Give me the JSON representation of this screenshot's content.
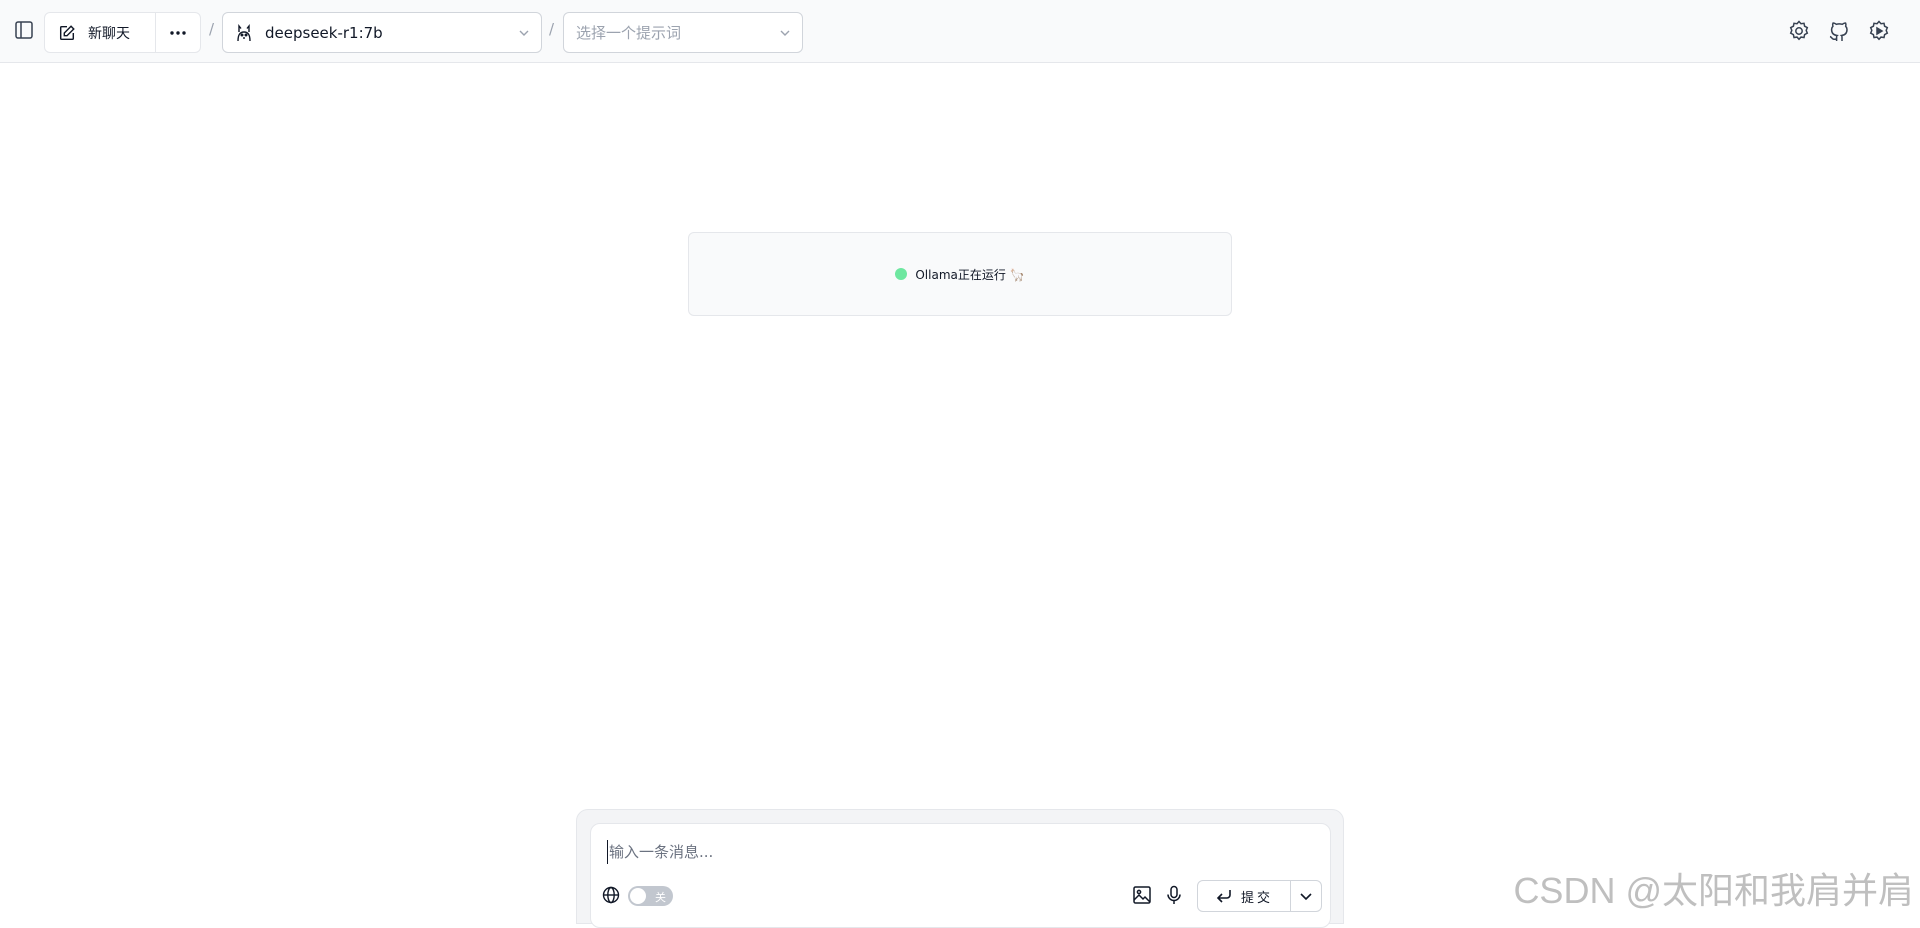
{
  "header": {
    "new_chat_label": "新聊天",
    "separator": "/",
    "model_select": {
      "selected": "deepseek-r1:7b"
    },
    "prompt_select": {
      "placeholder": "选择一个提示词"
    }
  },
  "status": {
    "text": "Ollama正在运行 🦙",
    "dot_color": "#6ee7a0"
  },
  "composer": {
    "placeholder": "输入一条消息...",
    "web_toggle_label": "关",
    "submit_label": "提交"
  },
  "watermark": "CSDN @太阳和我肩并肩",
  "icons": {
    "sidebar": "sidebar-toggle-icon",
    "new_chat": "edit-icon",
    "more": "more-horizontal-icon",
    "model": "llama-icon",
    "settings": "gear-icon",
    "github": "github-icon",
    "theme": "sun-icon",
    "web": "globe-icon",
    "image": "image-icon",
    "mic": "microphone-icon",
    "submit": "enter-icon"
  }
}
